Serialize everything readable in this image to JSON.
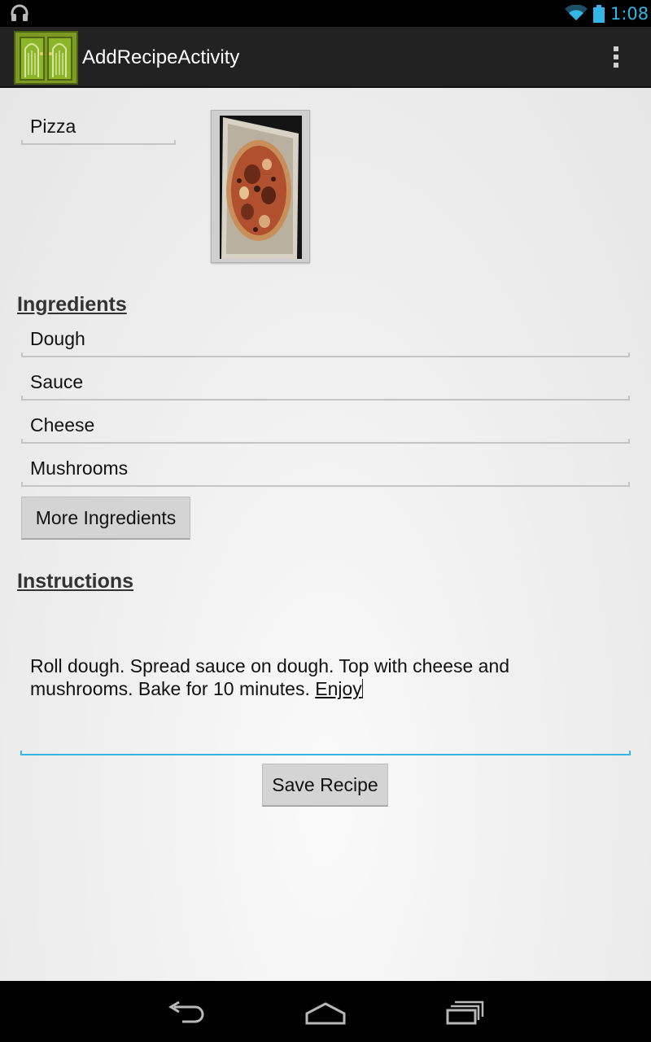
{
  "status_bar": {
    "time": "1:08",
    "icons": [
      "headset-icon",
      "wifi-icon",
      "battery-icon"
    ],
    "accent_color": "#33b5e5"
  },
  "action_bar": {
    "title": "AddRecipeActivity",
    "app_icon": "app-launcher-icon",
    "overflow_icon": "overflow-menu-icon",
    "background": "#222222"
  },
  "recipe": {
    "name_value": "Pizza",
    "photo_icon": "pizza-photo"
  },
  "ingredients": {
    "heading": "Ingredients",
    "items": [
      "Dough",
      "Sauce",
      "Cheese",
      "Mushrooms"
    ],
    "more_button_label": "More Ingredients"
  },
  "instructions": {
    "heading": "Instructions",
    "text_main": "Roll dough. Spread sauce on dough. Top with cheese and mushrooms. Bake for 10 minutes. ",
    "text_composing": "Enjoy",
    "focus_color": "#33b5e5"
  },
  "save_button_label": "Save Recipe",
  "nav_bar": {
    "icons": [
      "back-icon",
      "home-icon",
      "recent-apps-icon"
    ]
  }
}
